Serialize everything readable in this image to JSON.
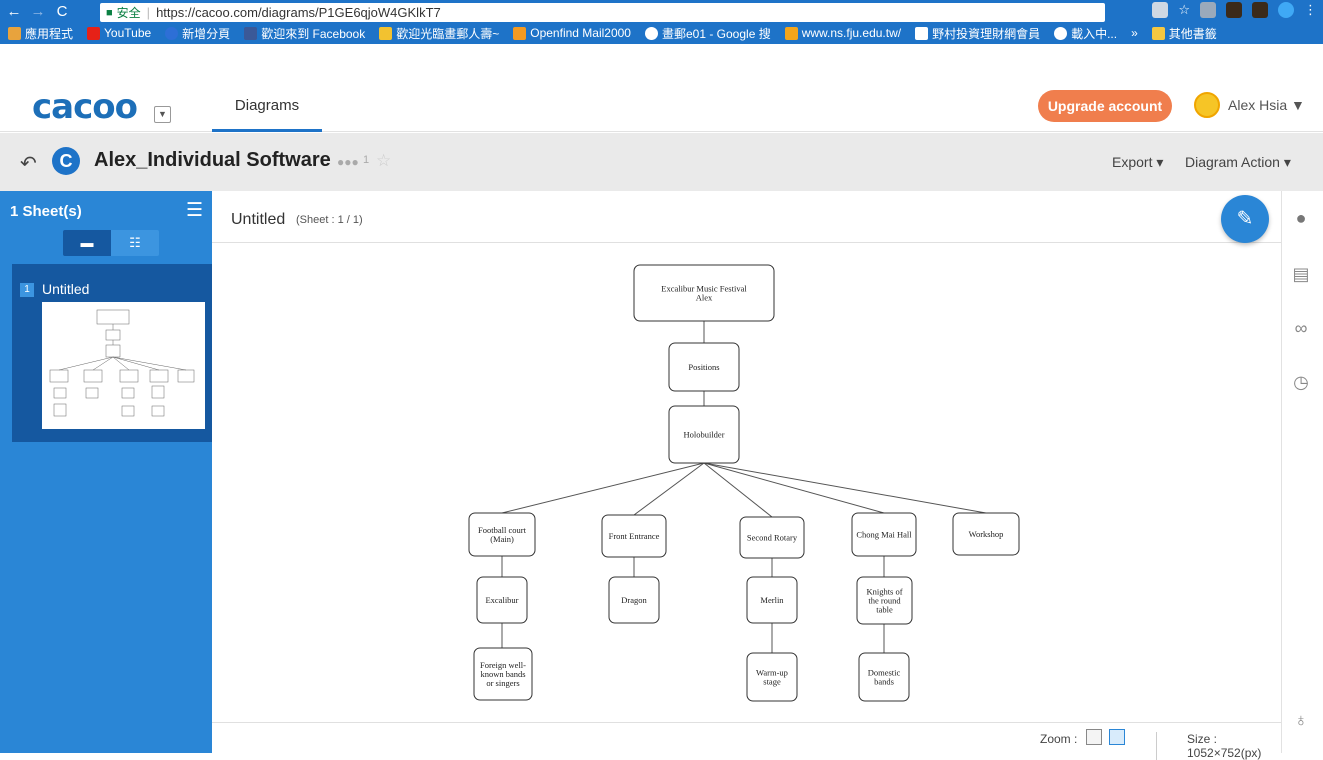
{
  "browser": {
    "secure_label": "安全",
    "url": "https://cacoo.com/diagrams/P1GE6qjoW4GKlkT7",
    "bookmarks": [
      "應用程式",
      "YouTube",
      "新增分頁",
      "歡迎來到 Facebook",
      "歡迎光臨畫郵人壽~",
      "Openfind Mail2000",
      "畫郵e01 - Google 搜",
      "www.ns.fju.edu.tw/",
      "野村投資理財網會員",
      "載入中...",
      "»",
      "其他書籤"
    ]
  },
  "app": {
    "logo": "cacoo",
    "tab": "Diagrams",
    "upgrade_label": "Upgrade account",
    "user_name": "Alex Hsia"
  },
  "diagram": {
    "title": "Alex_Individual Software",
    "collaborators": "1",
    "export_label": "Export",
    "action_label": "Diagram Action"
  },
  "sidebar": {
    "sheet_count": "1 Sheet(s)",
    "sheet_num": "1",
    "sheet_name": "Untitled"
  },
  "canvas": {
    "title": "Untitled",
    "sheet_indicator": "(Sheet : 1 / 1)",
    "zoom_label": "Zoom :",
    "size_label": "Size : 1052×752(px)"
  },
  "nodes": [
    {
      "id": "root",
      "lines": [
        "Excalibur Music Festival",
        "Alex"
      ]
    },
    {
      "id": "positions",
      "lines": [
        "Positions"
      ]
    },
    {
      "id": "holobuilder",
      "lines": [
        "Holobuilder"
      ]
    },
    {
      "id": "football",
      "lines": [
        "Football court",
        "(Main)"
      ]
    },
    {
      "id": "front",
      "lines": [
        "Front Entrance"
      ]
    },
    {
      "id": "rotary",
      "lines": [
        "Second Rotary"
      ]
    },
    {
      "id": "chong",
      "lines": [
        "Chong Mai Hall"
      ]
    },
    {
      "id": "workshop",
      "lines": [
        "Workshop"
      ]
    },
    {
      "id": "excalibur",
      "lines": [
        "Excalibur"
      ]
    },
    {
      "id": "dragon",
      "lines": [
        "Dragon"
      ]
    },
    {
      "id": "merlin",
      "lines": [
        "Merlin"
      ]
    },
    {
      "id": "knights",
      "lines": [
        "Knights of",
        "the round",
        "table"
      ]
    },
    {
      "id": "foreign",
      "lines": [
        "Foreign well-",
        "known bands",
        "or singers"
      ]
    },
    {
      "id": "warmup",
      "lines": [
        "Warm-up",
        "stage"
      ]
    },
    {
      "id": "domestic",
      "lines": [
        "Domestic",
        "bands"
      ]
    }
  ]
}
